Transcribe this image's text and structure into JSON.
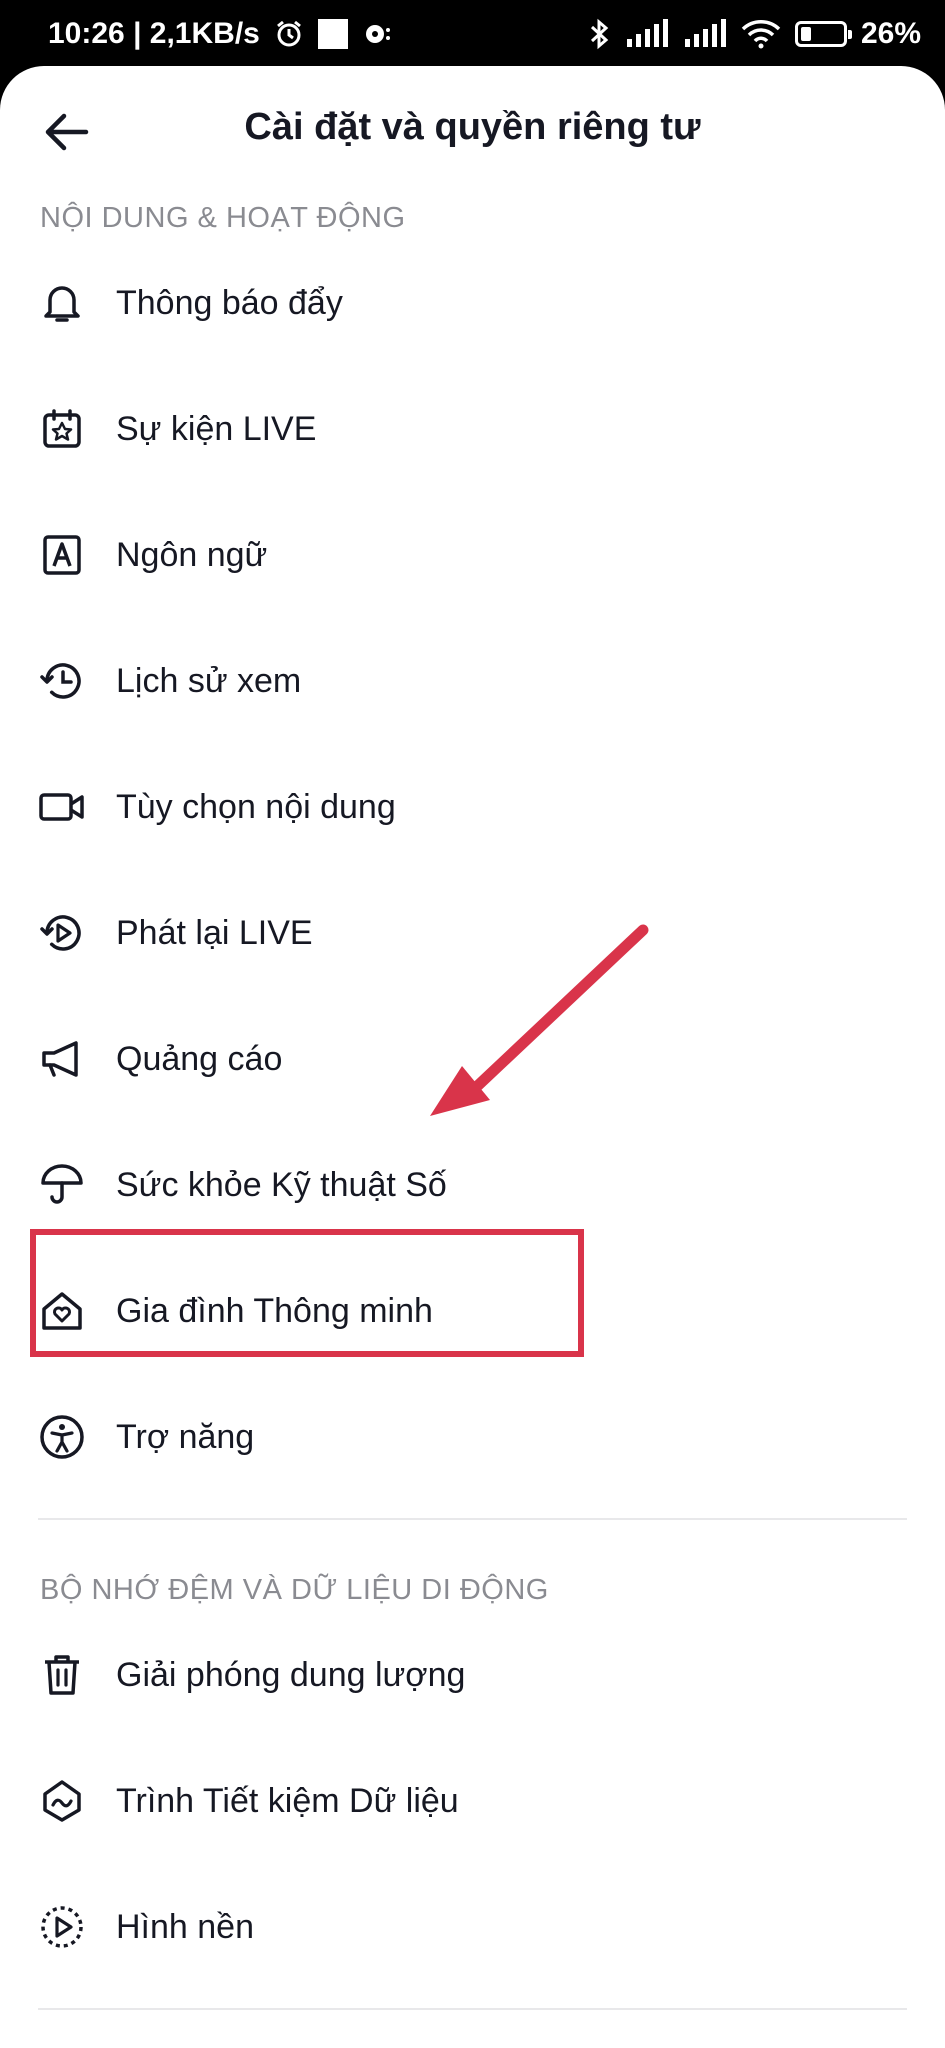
{
  "status_bar": {
    "time_speed": "10:26 | 2,1KB/s",
    "battery_percent": "26%",
    "battery_level": 0.26
  },
  "header": {
    "title": "Cài đặt và quyền riêng tư"
  },
  "sections": [
    {
      "title": "NỘI DUNG & HOẠT ĐỘNG",
      "items": [
        {
          "label": "Thông báo đẩy",
          "icon": "bell-icon"
        },
        {
          "label": "Sự kiện LIVE",
          "icon": "calendar-star-icon"
        },
        {
          "label": "Ngôn ngữ",
          "icon": "language-icon"
        },
        {
          "label": "Lịch sử xem",
          "icon": "history-icon"
        },
        {
          "label": "Tùy chọn nội dung",
          "icon": "video-camera-icon"
        },
        {
          "label": "Phát lại LIVE",
          "icon": "replay-icon"
        },
        {
          "label": "Quảng cáo",
          "icon": "megaphone-icon"
        },
        {
          "label": "Sức khỏe Kỹ thuật Số",
          "icon": "umbrella-icon"
        },
        {
          "label": "Gia đình Thông minh",
          "icon": "home-heart-icon"
        },
        {
          "label": "Trợ năng",
          "icon": "accessibility-icon"
        }
      ]
    },
    {
      "title": "BỘ NHỚ ĐỆM VÀ DỮ LIỆU DI ĐỘNG",
      "items": [
        {
          "label": "Giải phóng dung lượng",
          "icon": "trash-icon"
        },
        {
          "label": "Trình Tiết kiệm Dữ liệu",
          "icon": "data-saver-icon"
        },
        {
          "label": "Hình nền",
          "icon": "wallpaper-icon"
        }
      ]
    }
  ],
  "annotation": {
    "color": "#d9344a",
    "highlighted_item": "Sức khỏe Kỹ thuật Số"
  }
}
